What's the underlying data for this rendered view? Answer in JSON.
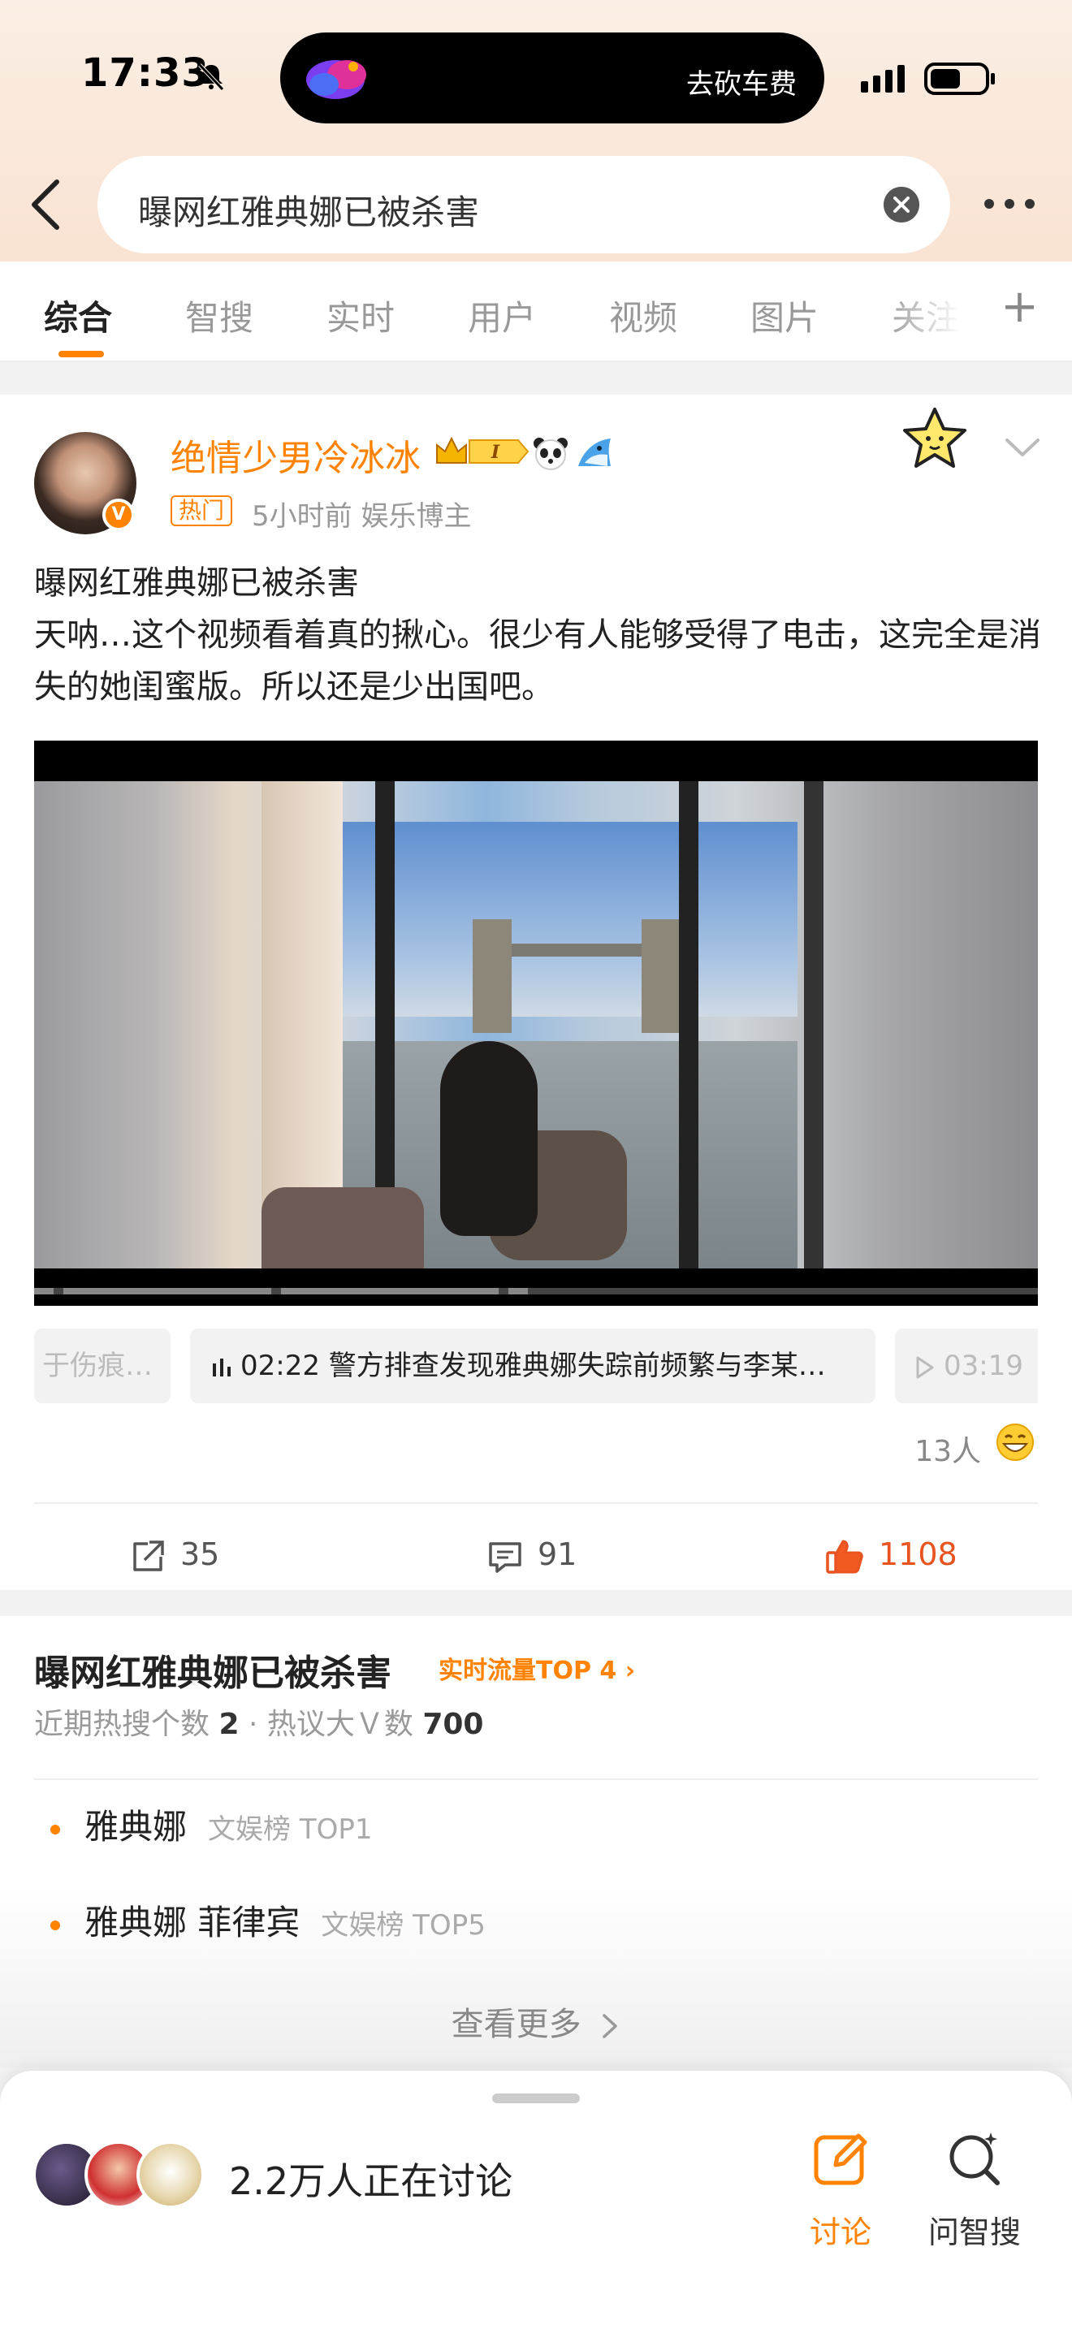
{
  "status_bar": {
    "time": "17:33",
    "island_text": "去砍车费"
  },
  "search": {
    "query": "曝网红雅典娜已被杀害"
  },
  "tabs": [
    {
      "label": "综合"
    },
    {
      "label": "智搜"
    },
    {
      "label": "实时"
    },
    {
      "label": "用户"
    },
    {
      "label": "视频"
    },
    {
      "label": "图片"
    },
    {
      "label": "关注"
    }
  ],
  "post": {
    "username": "绝情少男冷冰冰",
    "level_badge": "I",
    "hot_tag": "热门",
    "time": "5小时前",
    "category": "娱乐博主",
    "title": "曝网红雅典娜已被杀害",
    "body": "天呐…这个视频看着真的揪心。很少有人能够受得了电击，这完全是消失的她闺蜜版。所以还是少出国吧。",
    "chapters": [
      {
        "label": "于伤痕…"
      },
      {
        "label": "02:22 警方排查发现雅典娜失踪前频繁与李某…"
      },
      {
        "label": "03:19"
      }
    ],
    "viewers": "13人",
    "actions": {
      "repost": "35",
      "comment": "91",
      "like": "1108"
    }
  },
  "topic": {
    "title": "曝网红雅典娜已被杀害",
    "badge": "实时流量TOP 4",
    "stats_prefix": "近期热搜个数",
    "stats_hot_count": "2",
    "stats_mid": "· 热议大Ｖ数",
    "stats_v_count": "700",
    "items": [
      {
        "name": "雅典娜",
        "tag": "文娱榜 TOP1"
      },
      {
        "name": "雅典娜 菲律宾",
        "tag": "文娱榜 TOP5"
      }
    ],
    "see_more": "查看更多"
  },
  "bottom_sheet": {
    "discuss_count": "2.2万人正在讨论",
    "discuss_label": "讨论",
    "ask_label": "问智搜"
  },
  "colors": {
    "accent": "#ff8200",
    "like": "#e8531f"
  }
}
